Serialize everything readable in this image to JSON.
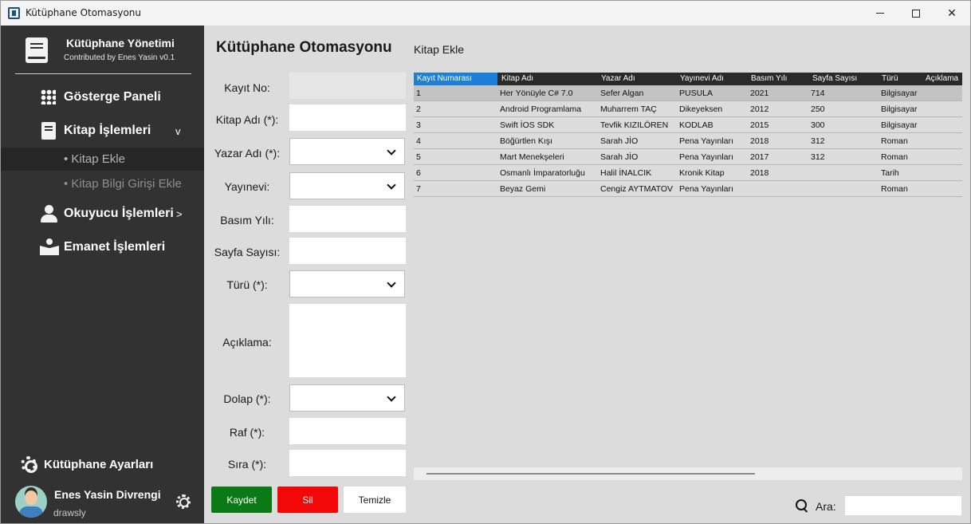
{
  "window": {
    "title": "Kütüphane Otomasyonu"
  },
  "sidebar": {
    "brand_title": "Kütüphane Yönetimi",
    "brand_subtitle": "Contributed by Enes Yasin v0.1",
    "items": [
      {
        "label": "Gösterge Paneli",
        "icon": "grid-icon"
      },
      {
        "label": "Kitap İşlemleri",
        "icon": "book-icon",
        "chevron": "v"
      },
      {
        "label": "Okuyucu İşlemleri",
        "icon": "user-icon",
        "chevron": ">"
      },
      {
        "label": "Emanet İşlemleri",
        "icon": "reader-icon"
      }
    ],
    "subitems": [
      {
        "label": "• Kitap Ekle",
        "active": true
      },
      {
        "label": "• Kitap Bilgi Girişi Ekle",
        "active": false
      }
    ],
    "settings_label": "Kütüphane Ayarları",
    "user_name": "Enes Yasin Divrengi",
    "user_sub": "drawsly"
  },
  "main": {
    "title": "Kütüphane Otomasyonu",
    "subtitle": "Kitap Ekle",
    "form": {
      "labels": [
        "Kayıt No:",
        "Kitap Adı (*):",
        "Yazar Adı (*):",
        "Yayınevi:",
        "Basım Yılı:",
        "Sayfa Sayısı:",
        "Türü (*):",
        "Açıklama:",
        "Dolap (*):",
        "Raf (*):",
        "Sıra (*):"
      ]
    },
    "buttons": {
      "save": "Kaydet",
      "delete": "Sil",
      "clear": "Temizle"
    },
    "grid": {
      "headers": [
        "Kayıt Numarası",
        "Kitap Adı",
        "Yazar Adı",
        "Yayınevi Adı",
        "Basım Yılı",
        "Sayfa Sayısı",
        "Türü",
        "Açıklama"
      ],
      "rows": [
        [
          "1",
          "Her Yönüyle C# 7.0",
          "Sefer Algan",
          "PUSULA",
          "2021",
          "714",
          "Bilgisayar"
        ],
        [
          "2",
          "Android Programlama",
          "Muharrem TAÇ",
          "Dikeyeksen",
          "2012",
          "250",
          "Bilgisayar"
        ],
        [
          "3",
          "Swift İOS SDK",
          "Tevfik KIZILÖREN",
          "KODLAB",
          "2015",
          "300",
          "Bilgisayar"
        ],
        [
          "4",
          "Böğürtlen Kışı",
          "Sarah JİO",
          "Pena Yayınları",
          "2018",
          "312",
          "Roman"
        ],
        [
          "5",
          "Mart Menekşeleri",
          "Sarah JİO",
          "Pena Yayınları",
          "2017",
          "312",
          "Roman"
        ],
        [
          "6",
          "Osmanlı İmparatorluğu",
          "Halil İNALCIK",
          "Kronik Kitap",
          "2018",
          "",
          "Tarih"
        ],
        [
          "7",
          "Beyaz Gemi",
          "Cengiz AYTMATOV",
          "Pena Yayınları",
          "",
          "",
          "Roman"
        ]
      ]
    },
    "search_label": "Ara:"
  }
}
